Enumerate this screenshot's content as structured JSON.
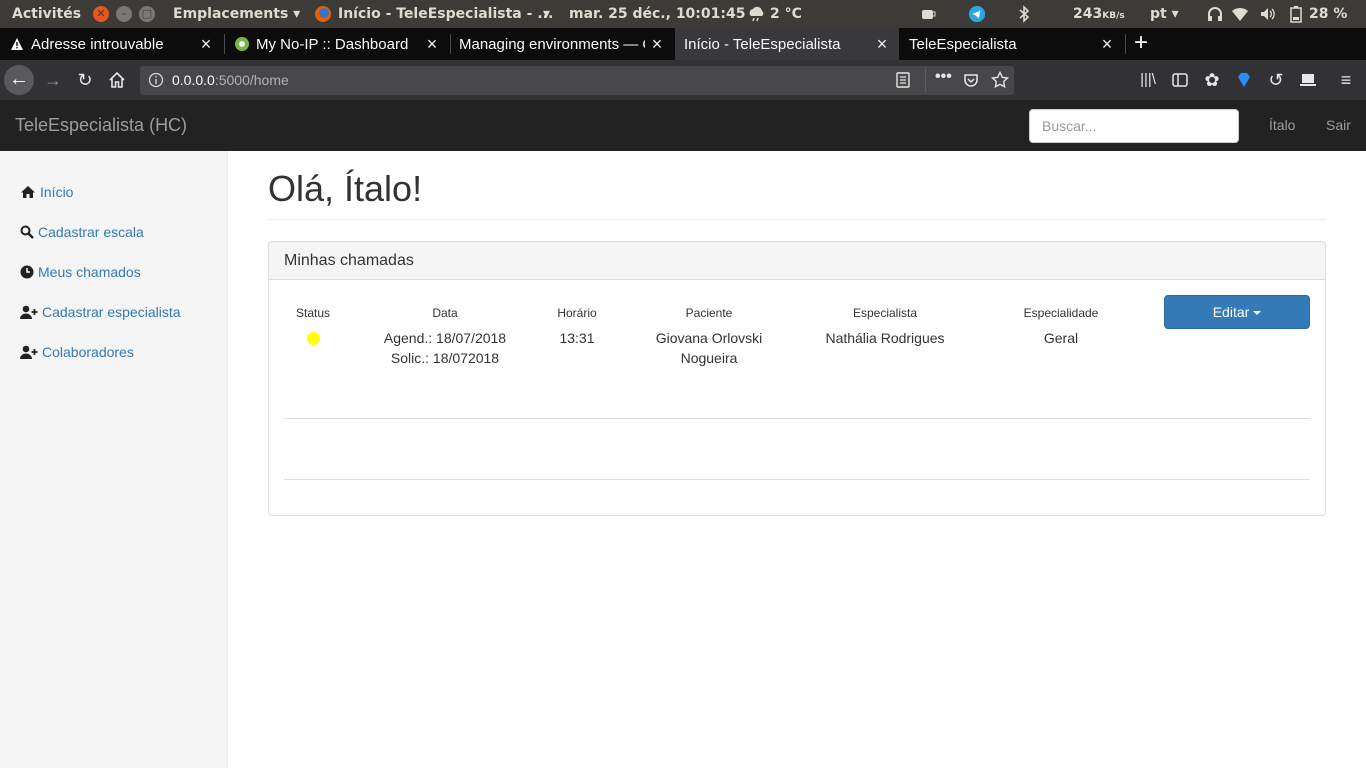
{
  "os_bar": {
    "activities": "Activités",
    "app_menu": "Emplacements",
    "window_title": "Início - TeleEspecialista - ...",
    "datetime": "mar. 25 déc., 10:01:45",
    "weather": "2 °C",
    "net_speed": "243",
    "net_unit": "KB/s",
    "lang": "pt",
    "battery": "28 %"
  },
  "browser": {
    "tabs": [
      {
        "label": "Adresse introuvable"
      },
      {
        "label": "My No-IP :: Dashboard"
      },
      {
        "label": "Managing environments — C"
      },
      {
        "label": "Início - TeleEspecialista"
      },
      {
        "label": "TeleEspecialista"
      }
    ],
    "url_host": "0.0.0.0",
    "url_path": ":5000/home"
  },
  "app": {
    "brand": "TeleEspecialista (HC)",
    "search_placeholder": "Buscar...",
    "user_link": "Ítalo",
    "logout_link": "Sair"
  },
  "sidebar": {
    "items": [
      {
        "label": "Início",
        "icon": "home-icon"
      },
      {
        "label": "Cadastrar escala",
        "icon": "search-icon"
      },
      {
        "label": "Meus chamados",
        "icon": "clock-icon"
      },
      {
        "label": "Cadastrar especialista",
        "icon": "user-plus-icon"
      },
      {
        "label": "Colaboradores",
        "icon": "user-plus-icon"
      }
    ]
  },
  "main": {
    "greeting": "Olá, Ítalo!",
    "panel_title": "Minhas chamadas",
    "columns": [
      "Status",
      "Data",
      "Horário",
      "Paciente",
      "Especialista",
      "Especialidade"
    ],
    "rows": [
      {
        "status_color": "#ffff00",
        "date_agend": "Agend.: 18/07/2018",
        "date_solic": "Solic.: 18/072018",
        "time": "13:31",
        "patient_line1": "Giovana Orlovski",
        "patient_line2": "Nogueira",
        "specialist": "Nathália Rodrigues",
        "specialty": "Geral"
      }
    ],
    "edit_button": "Editar"
  }
}
